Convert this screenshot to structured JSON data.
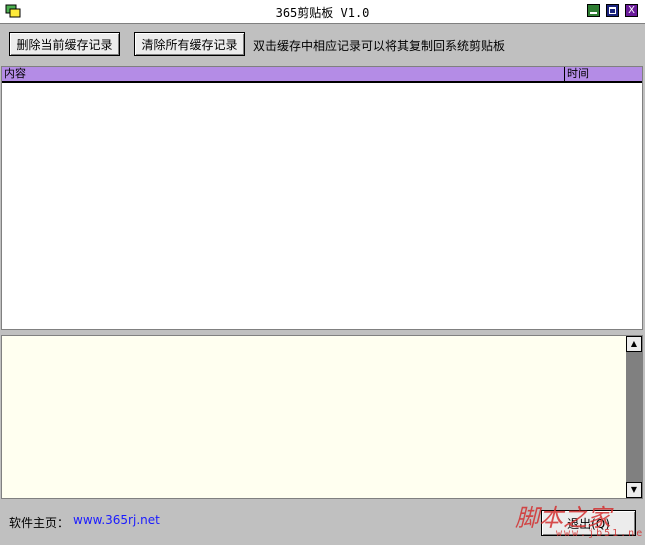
{
  "window": {
    "title": "365剪贴板 V1.0",
    "close_glyph": "X"
  },
  "toolbar": {
    "delete_current_label": "删除当前缓存记录",
    "clear_all_label": "清除所有缓存记录",
    "hint": "双击缓存中相应记录可以将其复制回系统剪贴板"
  },
  "list": {
    "columns": [
      "内容",
      "时间"
    ],
    "rows": []
  },
  "editor": {
    "value": ""
  },
  "footer": {
    "homepage_label": "软件主页：",
    "homepage_link": "www.365rj.net",
    "exit_label": "退出(Q)"
  },
  "watermark": {
    "text": "脚本之家",
    "url": "www.jb51.net"
  },
  "colors": {
    "header": "#b48ce6",
    "editor_bg": "#fffff0",
    "link": "#1a1aff",
    "watermark": "#d32f2f"
  },
  "icons": [
    "app-icon",
    "minimize-icon",
    "maximize-icon",
    "close-icon",
    "scroll-up-arrow-icon",
    "scroll-down-arrow-icon"
  ]
}
